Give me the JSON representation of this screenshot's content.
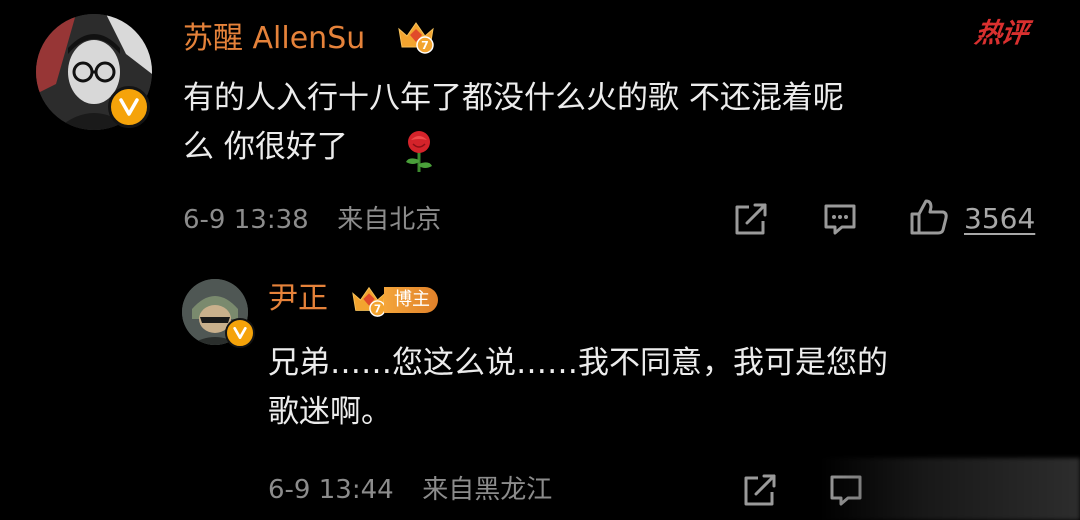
{
  "hot_tag": "热评",
  "comment": {
    "username": "苏醒 AllenSu",
    "text_line1": "有的人入行十八年了都没什么火的歌 不还混着呢",
    "text_line2": "么 你很好了",
    "emoji": "rose-emoji",
    "date": "6-9 13:38",
    "location": "来自北京",
    "like_count": "3564"
  },
  "reply": {
    "username": "尹正",
    "host_badge": "博主",
    "text_line1": "兄弟……您这么说……我不同意，我可是您的",
    "text_line2": "歌迷啊。",
    "date": "6-9 13:44",
    "location": "来自黑龙江"
  },
  "icons": {
    "share": "share-icon",
    "comment": "comment-icon",
    "like": "thumbs-up-icon",
    "verified": "verified-v-icon",
    "crown": "vip-crown-icon"
  },
  "colors": {
    "background": "#000000",
    "username": "#e5823a",
    "hot_tag": "#d9302f",
    "meta_text": "#8c8c8c",
    "verified_badge": "#f5a30a"
  }
}
